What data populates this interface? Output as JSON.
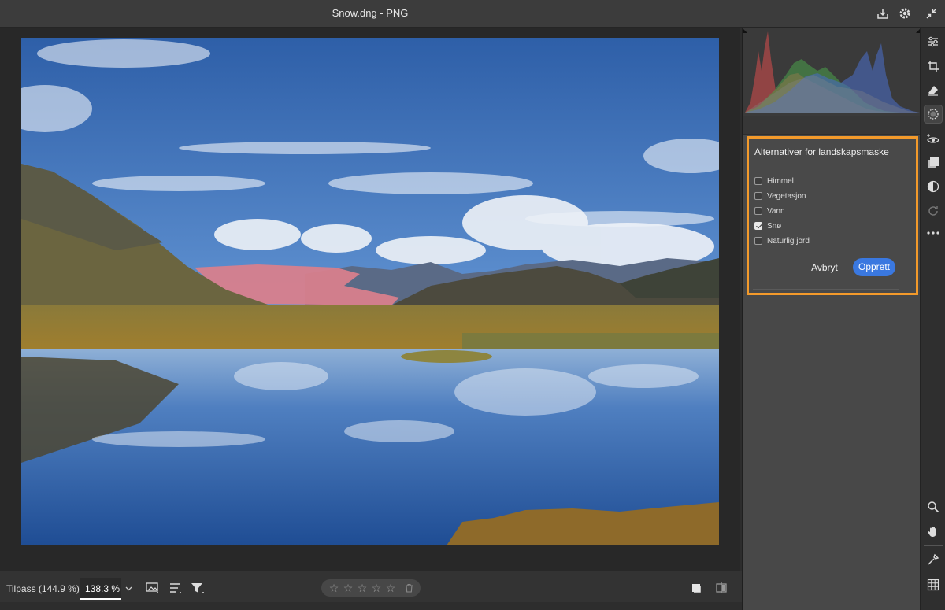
{
  "window": {
    "title": "Snow.dng  -  PNG"
  },
  "titlebar_icons": [
    "download-icon",
    "gear-icon",
    "collapse-icon"
  ],
  "bottom_bar": {
    "zoom_fit_label": "Tilpass (144.9 %)",
    "zoom_value": "138.3 %",
    "rating_stars": 5,
    "rating_value": 0
  },
  "mask_options": {
    "title": "Alternativer for landskapsmaske",
    "options": [
      {
        "label": "Himmel",
        "checked": false
      },
      {
        "label": "Vegetasjon",
        "checked": false
      },
      {
        "label": "Vann",
        "checked": false
      },
      {
        "label": "Snø",
        "checked": true
      },
      {
        "label": "Naturlig jord",
        "checked": false
      }
    ],
    "cancel_label": "Avbryt",
    "create_label": "Opprett"
  },
  "colors": {
    "accent": "#f39a2b",
    "primary_button": "#3a78e0"
  },
  "tools": [
    "edit-sliders-icon",
    "crop-icon",
    "eraser-icon",
    "masking-icon",
    "red-eye-icon",
    "presets-icon",
    "color-icon",
    "snapshot-icon",
    "more-icon",
    "zoom-icon",
    "hand-icon",
    "sampler-icon",
    "grid-icon"
  ]
}
